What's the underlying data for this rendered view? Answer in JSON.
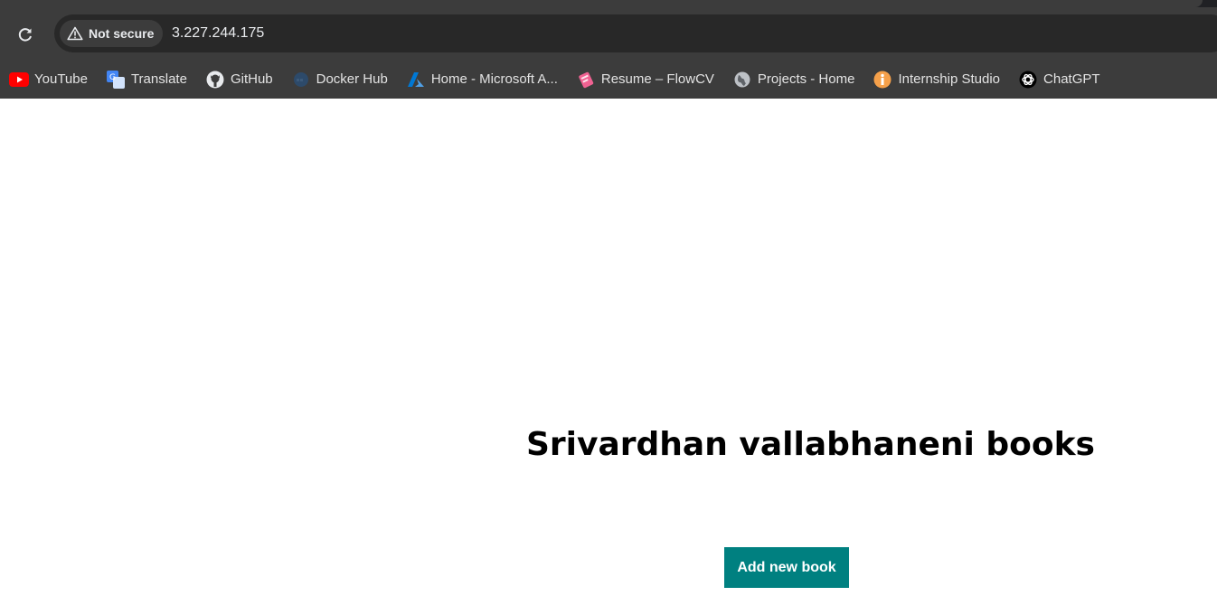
{
  "browser": {
    "security_label": "Not secure",
    "url": "3.227.244.175",
    "bookmarks": [
      {
        "label": "YouTube",
        "icon": "youtube-icon"
      },
      {
        "label": "Translate",
        "icon": "google-translate-icon"
      },
      {
        "label": "GitHub",
        "icon": "github-icon"
      },
      {
        "label": "Docker Hub",
        "icon": "docker-icon"
      },
      {
        "label": "Home - Microsoft A...",
        "icon": "azure-icon"
      },
      {
        "label": "Resume – FlowCV",
        "icon": "flowcv-icon"
      },
      {
        "label": "Projects - Home",
        "icon": "globe-icon"
      },
      {
        "label": "Internship Studio",
        "icon": "internship-studio-icon"
      },
      {
        "label": "ChatGPT",
        "icon": "chatgpt-icon"
      }
    ]
  },
  "page": {
    "title": "Srivardhan vallabhaneni books",
    "add_button_label": "Add new book",
    "colors": {
      "button": "#008080",
      "button_text": "#ffffff"
    }
  }
}
